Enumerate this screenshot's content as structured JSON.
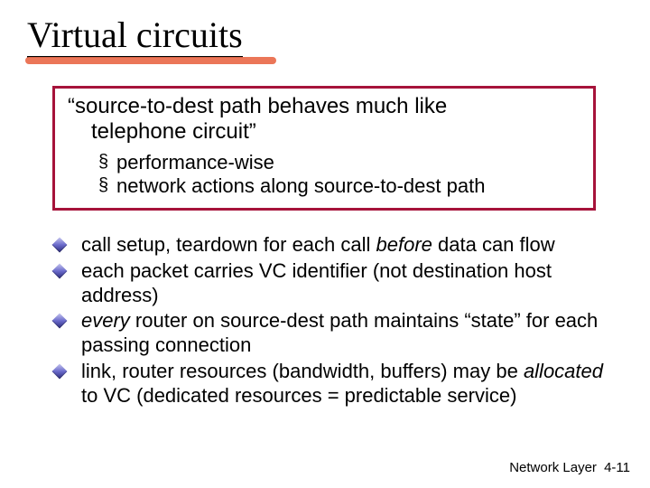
{
  "title": "Virtual circuits",
  "box": {
    "quote_line1": "“source-to-dest path behaves much like",
    "quote_line2": "telephone circuit”",
    "sub1": "performance-wise",
    "sub2": "network actions along source-to-dest path"
  },
  "bullets": {
    "b1_a": "call setup, teardown for each call ",
    "b1_b": "before",
    "b1_c": " data can flow",
    "b2": "each packet carries VC identifier (not destination host address)",
    "b3_a": "every",
    "b3_b": " router on source-dest path maintains “state” for each passing connection",
    "b4_a": "link, router resources (bandwidth, buffers) may be ",
    "b4_b": "allocated",
    "b4_c": " to VC (dedicated resources = predictable service)"
  },
  "footer": {
    "chapter": "Network Layer",
    "page": "4-11"
  }
}
